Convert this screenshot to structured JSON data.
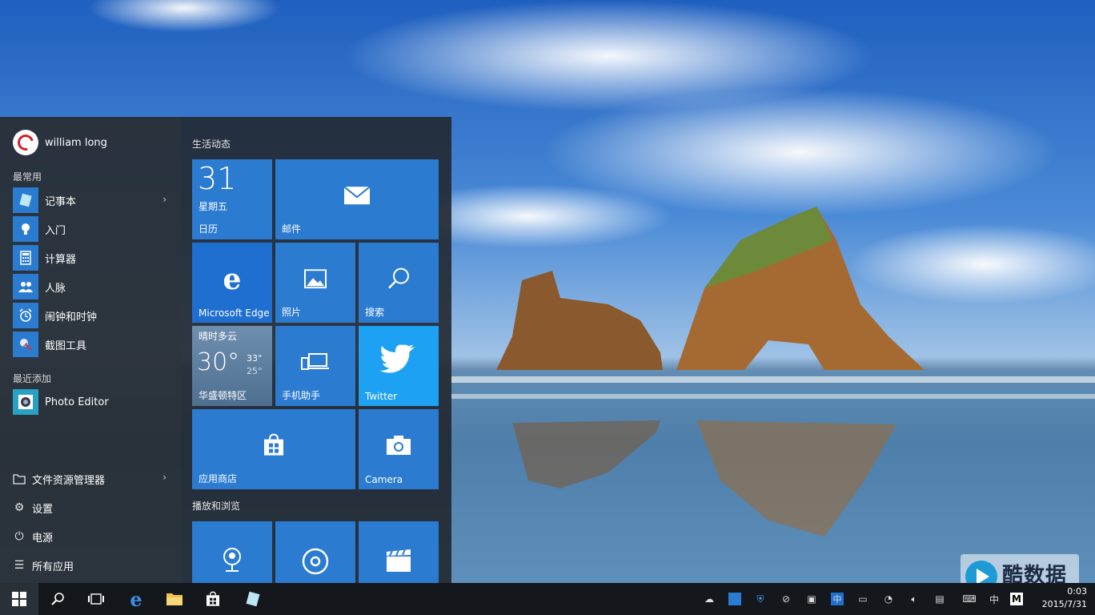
{
  "start_menu": {
    "user_name": "william long",
    "most_used_label": "最常用",
    "most_used": [
      {
        "label": "记事本",
        "icon": "notepad-icon",
        "has_submenu": true
      },
      {
        "label": "入门",
        "icon": "lightbulb-icon"
      },
      {
        "label": "计算器",
        "icon": "calculator-icon"
      },
      {
        "label": "人脉",
        "icon": "people-icon"
      },
      {
        "label": "闹钟和时钟",
        "icon": "alarm-clock-icon"
      },
      {
        "label": "截图工具",
        "icon": "snipping-tool-icon"
      }
    ],
    "recently_added_label": "最近添加",
    "recently_added": [
      {
        "label": "Photo Editor",
        "icon": "photo-editor-icon"
      }
    ],
    "system_items": [
      {
        "label": "文件资源管理器",
        "icon": "file-explorer-icon",
        "has_submenu": true
      },
      {
        "label": "设置",
        "icon": "gear-icon"
      },
      {
        "label": "电源",
        "icon": "power-icon"
      },
      {
        "label": "所有应用",
        "icon": "list-icon"
      }
    ],
    "groups": [
      {
        "label": "生活动态"
      },
      {
        "label": "播放和浏览"
      }
    ],
    "tiles": {
      "calendar": {
        "day_number": "31",
        "weekday": "星期五",
        "label": "日历"
      },
      "mail": {
        "label": "邮件"
      },
      "edge": {
        "label": "Microsoft Edge"
      },
      "photos": {
        "label": "照片"
      },
      "search": {
        "label": "搜索"
      },
      "weather": {
        "condition": "晴时多云",
        "temp": "30°",
        "high": "33°",
        "low": "25°",
        "location": "华盛顿特区"
      },
      "phone": {
        "label": "手机助手"
      },
      "twitter": {
        "label": "Twitter"
      },
      "store": {
        "label": "应用商店"
      },
      "camera": {
        "label": "Camera"
      }
    }
  },
  "taskbar": {
    "clock_time": "0:03",
    "clock_date": "2015/7/31",
    "ime_label": "中",
    "ime_mode": "M"
  },
  "watermark": {
    "text": "酷数据"
  },
  "colors": {
    "tile_blue": "#2b7bd1",
    "edge_blue": "#1e6fd0",
    "twitter_blue": "#1da1f2",
    "menu_bg": "#222830",
    "taskbar_bg": "#14181d"
  }
}
